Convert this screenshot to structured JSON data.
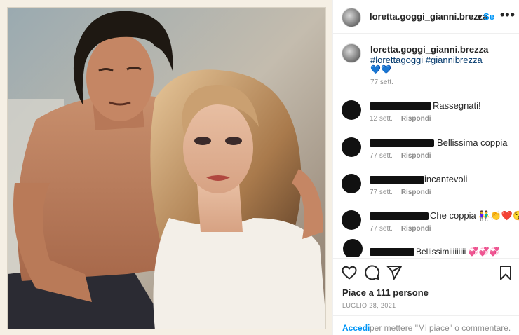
{
  "post": {
    "username": "loretta.goggi_gianni.brezza",
    "separator": "•",
    "follow_label": "Se",
    "more_label": "•••"
  },
  "caption": {
    "username": "loretta.goggi_gianni.brezza",
    "hashtags": "#lorettagoggi #giannibrezza",
    "emoji": "💙💙",
    "time": "77 sett."
  },
  "comments": [
    {
      "text": "Rassegnati!",
      "time": "12 sett.",
      "reply": "Rispondi"
    },
    {
      "text": "Bellissima coppia",
      "time": "77 sett.",
      "reply": "Rispondi"
    },
    {
      "text": "incantevoli",
      "time": "77 sett.",
      "reply": "Rispondi"
    },
    {
      "text": "Che coppia 👫👏❤️😘",
      "time": "77 sett.",
      "reply": "Rispondi"
    },
    {
      "text": "Bellissimiiiiiiiii 💞💞💞",
      "time": "",
      "reply": ""
    }
  ],
  "actions": {
    "like_icon": "heart-icon",
    "comment_icon": "comment-icon",
    "share_icon": "share-icon",
    "save_icon": "bookmark-icon"
  },
  "likes_text": "Piace a 111 persone",
  "date_text": "LUGLIO 28, 2021",
  "footer": {
    "login_link": "Accedi",
    "login_rest": "per mettere \"Mi piace\" o commentare."
  }
}
